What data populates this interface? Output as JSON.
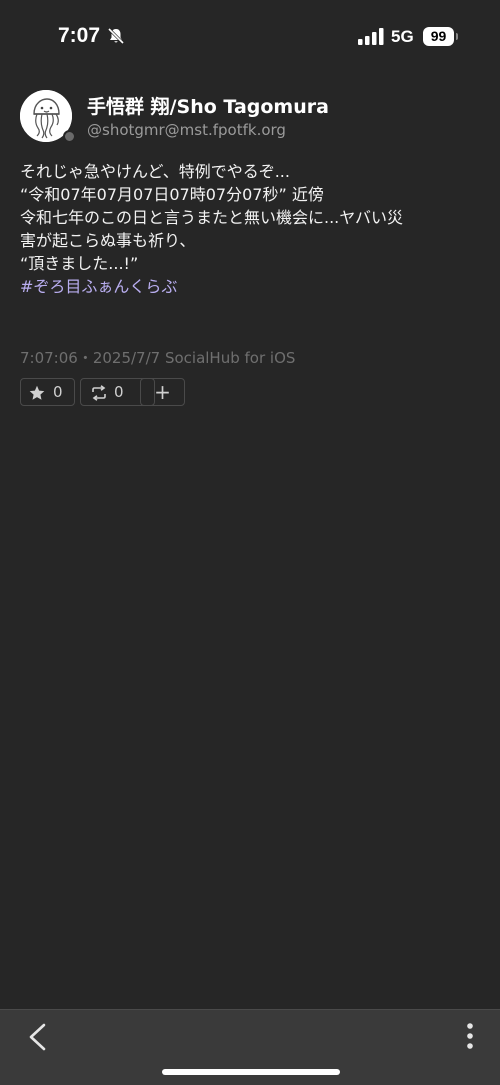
{
  "status_bar": {
    "time": "7:07",
    "network": "5G",
    "battery": "99",
    "icons": [
      "bell-slash-icon",
      "signal-bars-icon",
      "battery-icon"
    ]
  },
  "post": {
    "display_name": "手悟群 翔/Sho Tagomura",
    "handle": "@shotgmr@mst.fpotfk.org",
    "avatar_icon": "jellyfish-avatar-icon",
    "body_lines": [
      "それじゃ急やけんど、特例でやるぞ...",
      "“令和07年07月07日07時07分07秒” 近傍",
      "令和七年のこの日と言うまたと無い機会に...ヤバい災",
      "害が起こらぬ事も祈り、",
      "“頂きました...!”"
    ],
    "hashtag": "#ぞろ目ふぁんくらぶ",
    "meta": "7:07:06・2025/7/7  SocialHub for iOS",
    "favorite_count": "0",
    "boost_count": "0",
    "add_label": "+"
  },
  "colors": {
    "background": "#262626",
    "hashtag": "#b9aef0",
    "muted": "#6f6f6f",
    "bottom_bar": "#3a3a3a"
  },
  "bottom_bar": {
    "icons": [
      "chevron-left-icon",
      "more-vertical-icon"
    ]
  }
}
